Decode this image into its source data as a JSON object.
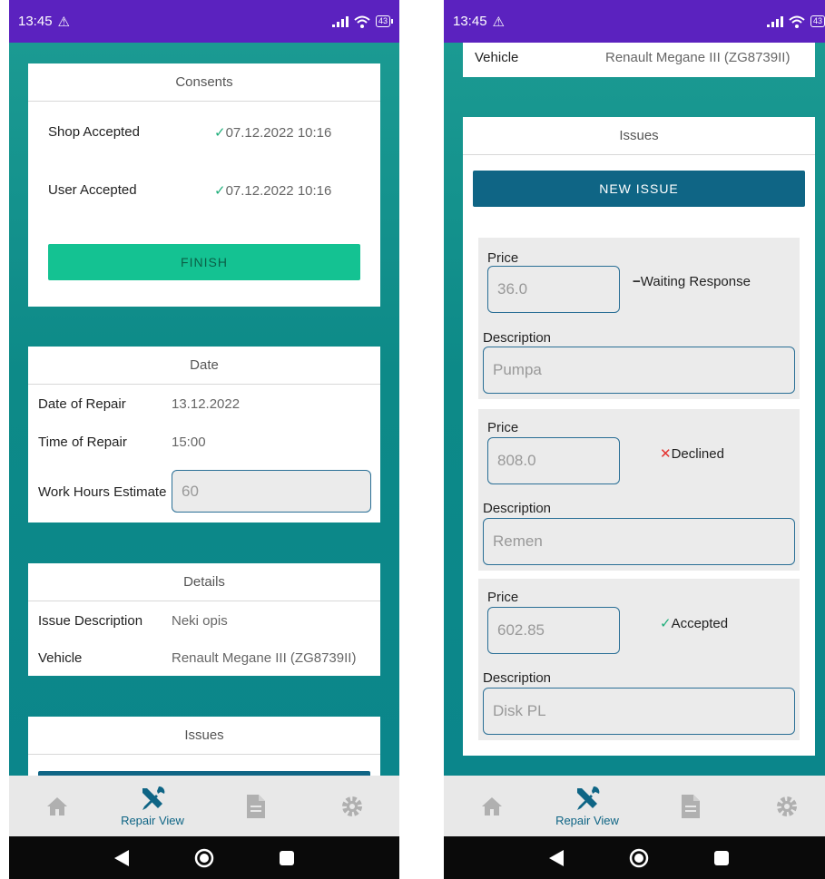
{
  "status_bar": {
    "time": "13:45",
    "battery": "43"
  },
  "left": {
    "consents": {
      "title": "Consents",
      "shop_label": "Shop Accepted",
      "shop_value": "07.12.2022 10:16",
      "user_label": "User Accepted",
      "user_value": "07.12.2022 10:16",
      "finish_label": "FINISH"
    },
    "date": {
      "title": "Date",
      "date_label": "Date of Repair",
      "date_value": "13.12.2022",
      "time_label": "Time of Repair",
      "time_value": "15:00",
      "hours_label": "Work Hours Estimate",
      "hours_value": "60"
    },
    "details": {
      "title": "Details",
      "issue_label": "Issue Description",
      "issue_value": "Neki opis",
      "vehicle_label": "Vehicle",
      "vehicle_value": "Renault Megane III (ZG8739II)"
    },
    "issues": {
      "title": "Issues"
    }
  },
  "right": {
    "vehicle_label": "Vehicle",
    "vehicle_value": "Renault Megane III (ZG8739II)",
    "issues": {
      "title": "Issues",
      "new_issue_label": "NEW ISSUE",
      "price_label": "Price",
      "description_label": "Description",
      "items": [
        {
          "price": "36.0",
          "status": "Waiting Response",
          "description": "Pumpa"
        },
        {
          "price": "808.0",
          "status": "Declined",
          "description": "Remen"
        },
        {
          "price": "602.85",
          "status": "Accepted",
          "description": "Disk PL"
        }
      ]
    }
  },
  "bottom_nav": {
    "repair_label": "Repair View"
  },
  "colors": {
    "status_bar": "#5b22bf",
    "accent": "#0f6585",
    "finish": "#14c292",
    "teal": "#0d8a88",
    "accepted": "#1fae7a",
    "declined": "#e4312e"
  }
}
